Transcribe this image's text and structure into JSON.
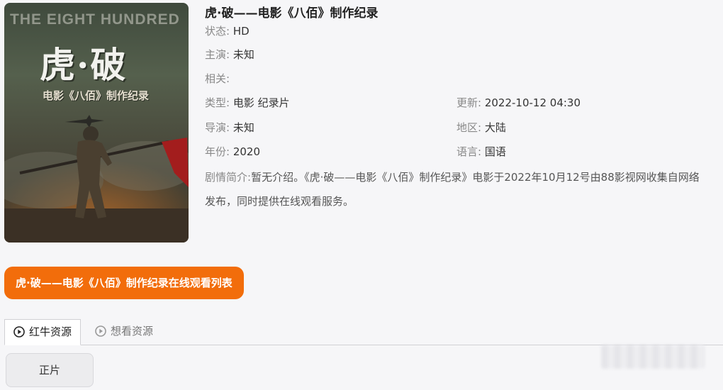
{
  "poster": {
    "title_en": "THE EIGHT HUNDRED",
    "title_cn": "虎·破",
    "subtitle": "电影《八佰》制作纪录"
  },
  "title": "虎·破——电影《八佰》制作纪录",
  "fields": {
    "status": {
      "label": "状态:",
      "value": "HD"
    },
    "cast": {
      "label": "主演:",
      "value": "未知"
    },
    "related": {
      "label": "相关:",
      "value": ""
    },
    "type": {
      "label": "类型:",
      "value": "电影 纪录片"
    },
    "updated": {
      "label": "更新:",
      "value": "2022-10-12 04:30"
    },
    "director": {
      "label": "导演:",
      "value": "未知"
    },
    "region": {
      "label": "地区:",
      "value": "大陆"
    },
    "year": {
      "label": "年份:",
      "value": "2020"
    },
    "language": {
      "label": "语言:",
      "value": "国语"
    }
  },
  "synopsis": {
    "label": "剧情简介:",
    "text": "暂无介绍。《虎·破——电影《八佰》制作纪录》电影于2022年10月12号由88影视网收集自网络发布，同时提供在线观看服务。"
  },
  "watch_list_button": "虎·破——电影《八佰》制作纪录在线观看列表",
  "tabs": [
    {
      "label": "红牛资源",
      "icon": "play-circle-icon",
      "active": true
    },
    {
      "label": "想看资源",
      "icon": "play-circle-icon",
      "active": false
    }
  ],
  "episode_button": "正片",
  "colors": {
    "accent": "#f26d0b",
    "background": "#f6f6f8"
  }
}
